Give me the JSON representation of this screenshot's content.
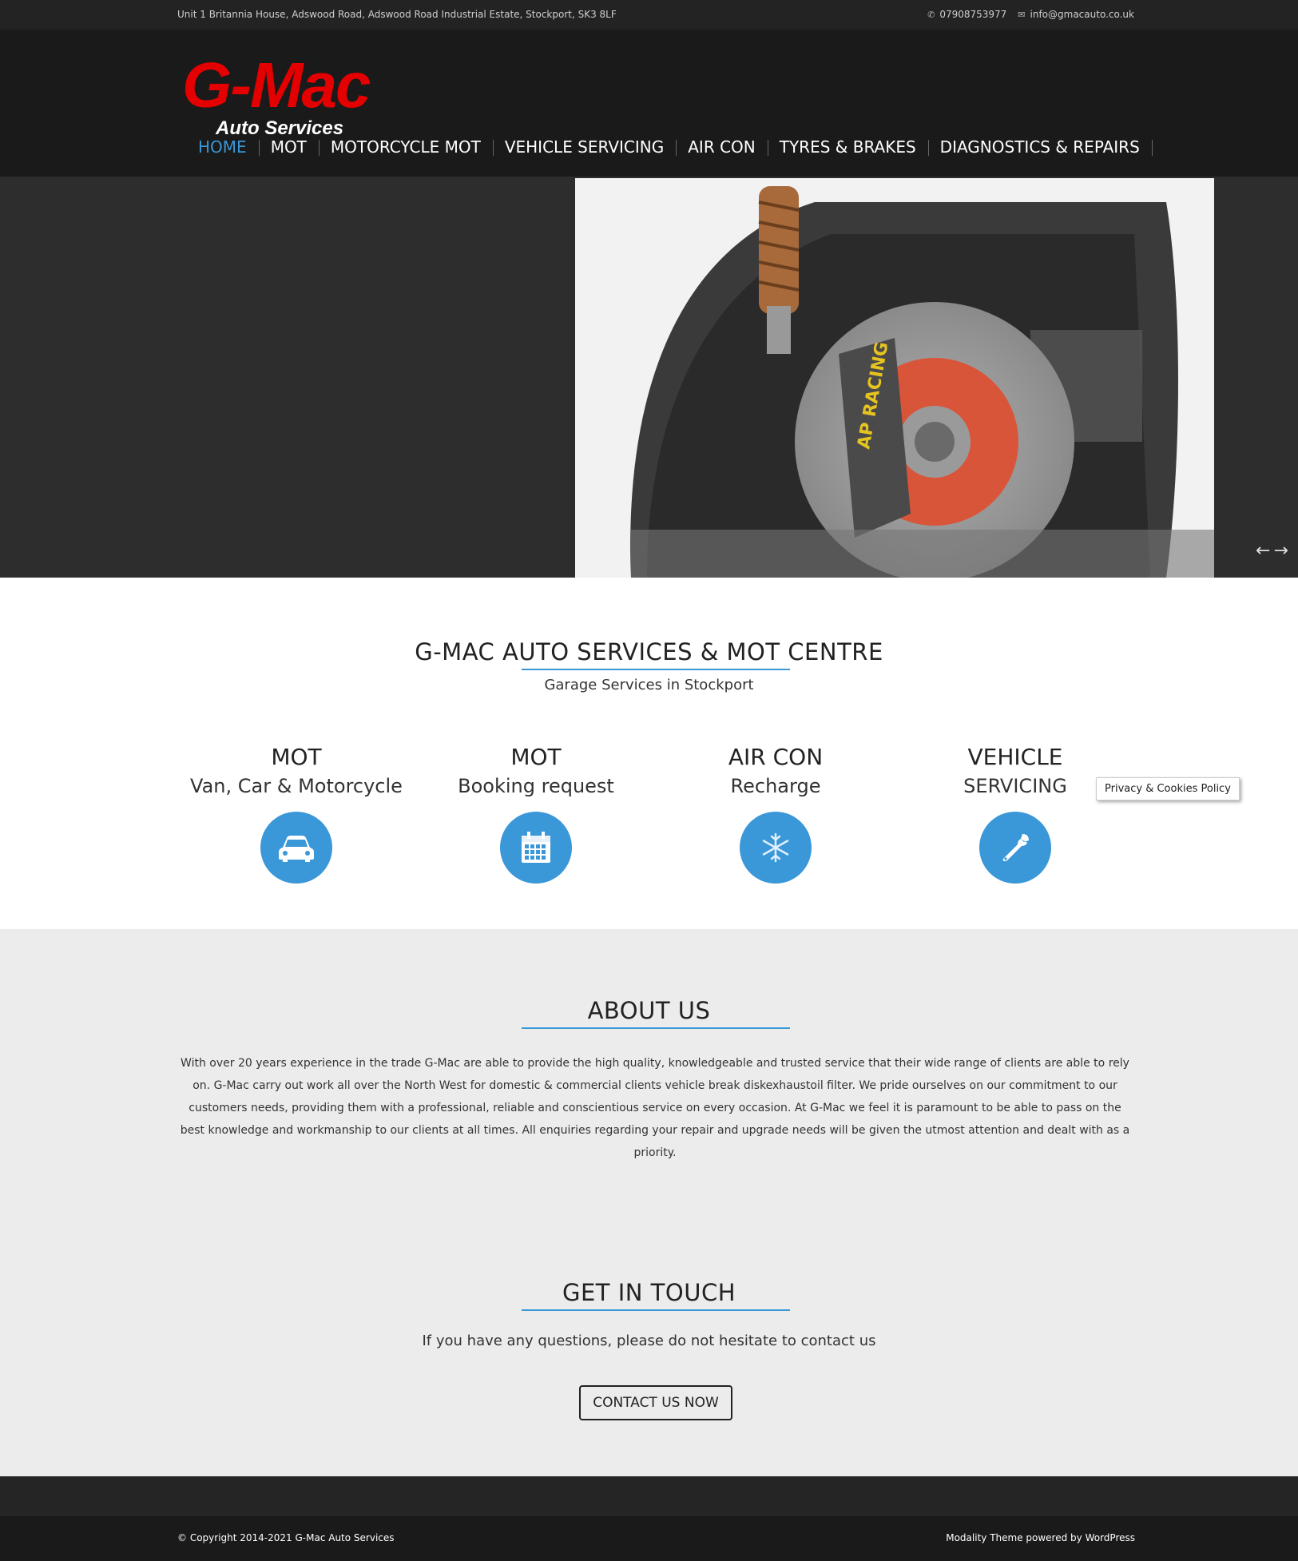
{
  "topbar": {
    "address": "Unit 1 Britannia House, Adswood Road, Adswood Road Industrial Estate, Stockport, SK3 8LF",
    "phone": "07908753977",
    "email": "info@gmacauto.co.uk"
  },
  "logo": {
    "main": "G-Mac",
    "sub": "Auto Services"
  },
  "nav": [
    "HOME",
    "MOT",
    "MOTORCYCLE MOT",
    "VEHICLE SERVICING",
    "AIR CON",
    "TYRES & BRAKES",
    "DIAGNOSTICS & REPAIRS"
  ],
  "hero": {
    "slides": 3,
    "active_slide": 3,
    "prev": "←",
    "next": "→"
  },
  "intro": {
    "title": "G-MAC AUTO SERVICES & MOT CENTRE",
    "subtitle": "Garage Services in Stockport"
  },
  "features": [
    {
      "line1": "MOT",
      "line2": "Van, Car & Motorcycle",
      "icon": "car-icon"
    },
    {
      "line1": "MOT",
      "line2": "Booking request",
      "icon": "calendar-icon"
    },
    {
      "line1": "AIR CON",
      "line2": "Recharge",
      "icon": "snowflake-icon"
    },
    {
      "line1": "VEHICLE",
      "line2": "SERVICING",
      "icon": "wrench-icon"
    }
  ],
  "privacy": "Privacy & Cookies Policy",
  "about": {
    "title": "ABOUT US",
    "text": "With over 20 years experience in the trade G-Mac are able to provide the high quality, knowledgeable and trusted service that their wide range of clients are able to rely on. G-Mac carry out work all over the North West for domestic & commercial clients vehicle break diskexhaustoil filter. We pride ourselves on our commitment to our customers needs, providing them with a professional, reliable and conscientious service on every occasion. At G-Mac we feel it is paramount to be able to pass on the best knowledge and workmanship to our clients at all times. All enquiries regarding your repair and upgrade needs will be given the utmost attention and dealt with as a priority."
  },
  "contact": {
    "title": "GET IN TOUCH",
    "text": "If you have any questions, please do not hesitate to contact us",
    "button": "CONTACT US NOW"
  },
  "footer": {
    "copyright": "© Copyright 2014-2021 G-Mac Auto Services",
    "credit": "Modality Theme powered by WordPress"
  },
  "colors": {
    "accent": "#3a97d8",
    "brand_red": "#e40000",
    "dark": "#1a1a1a"
  }
}
